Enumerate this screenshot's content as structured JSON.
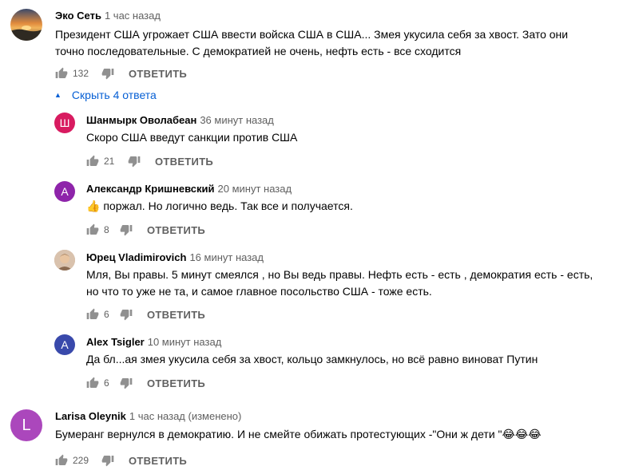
{
  "comments": [
    {
      "author": "Эко Сеть",
      "time": "1 час назад",
      "text_lines": [
        "Президент США угрожает США ввести войска США в США... Змея укусила себя за хвост. Зато они",
        "точно последовательные. С демократией не очень, нефть есть - все сходится"
      ],
      "likes": "132",
      "reply_label": "ОТВЕТИТЬ",
      "avatar_type": "photo-sunset"
    }
  ],
  "toggle_replies": {
    "label": "Скрыть 4 ответа",
    "icon": "caret-up-icon"
  },
  "replies": [
    {
      "author": "Шанмырк Оволабеан",
      "time": "36 минут назад",
      "text": "Скоро США введут санкции против США",
      "likes": "21",
      "reply_label": "ОТВЕТИТЬ",
      "avatar_letter": "Ш",
      "avatar_color": "#d81b60"
    },
    {
      "author": "Александр Кришневский",
      "time": "20 минут назад",
      "text": "поржал. Но логично ведь. Так все и получается.",
      "emoji": "👍",
      "likes": "8",
      "reply_label": "ОТВЕТИТЬ",
      "avatar_letter": "А",
      "avatar_color": "#8e24aa"
    },
    {
      "author": "Юрец Vladimirovich",
      "time": "16 минут назад",
      "text_lines": [
        "Мля, Вы правы. 5 минут смеялся , но Вы ведь правы. Нефть есть - есть , демократия есть - есть,",
        "но что то уже не та, и самое главное посольство США - тоже есть."
      ],
      "likes": "6",
      "reply_label": "ОТВЕТИТЬ",
      "avatar_type": "photo-person"
    },
    {
      "author": "Alex Tsigler",
      "time": "10 минут назад",
      "text": "Да бл...ая змея укусила себя за хвост, кольцо замкнулось, но всё равно виноват Путин",
      "likes": "6",
      "reply_label": "ОТВЕТИТЬ",
      "avatar_letter": "A",
      "avatar_color": "#3949ab"
    }
  ],
  "comment2": {
    "author": "Larisa Oleynik",
    "time": "1 час назад (изменено)",
    "text": "Бумеранг вернулся в демократию. И не смейте обижать протестующих -\"Они ж дети \"",
    "emojis": "😂😂😂",
    "likes": "229",
    "reply_label": "ОТВЕТИТЬ",
    "avatar_letter": "L",
    "avatar_color": "#ab47bc"
  },
  "colors": {
    "link": "#065fd4",
    "secondary_text": "#606060",
    "icon": "#909090"
  }
}
